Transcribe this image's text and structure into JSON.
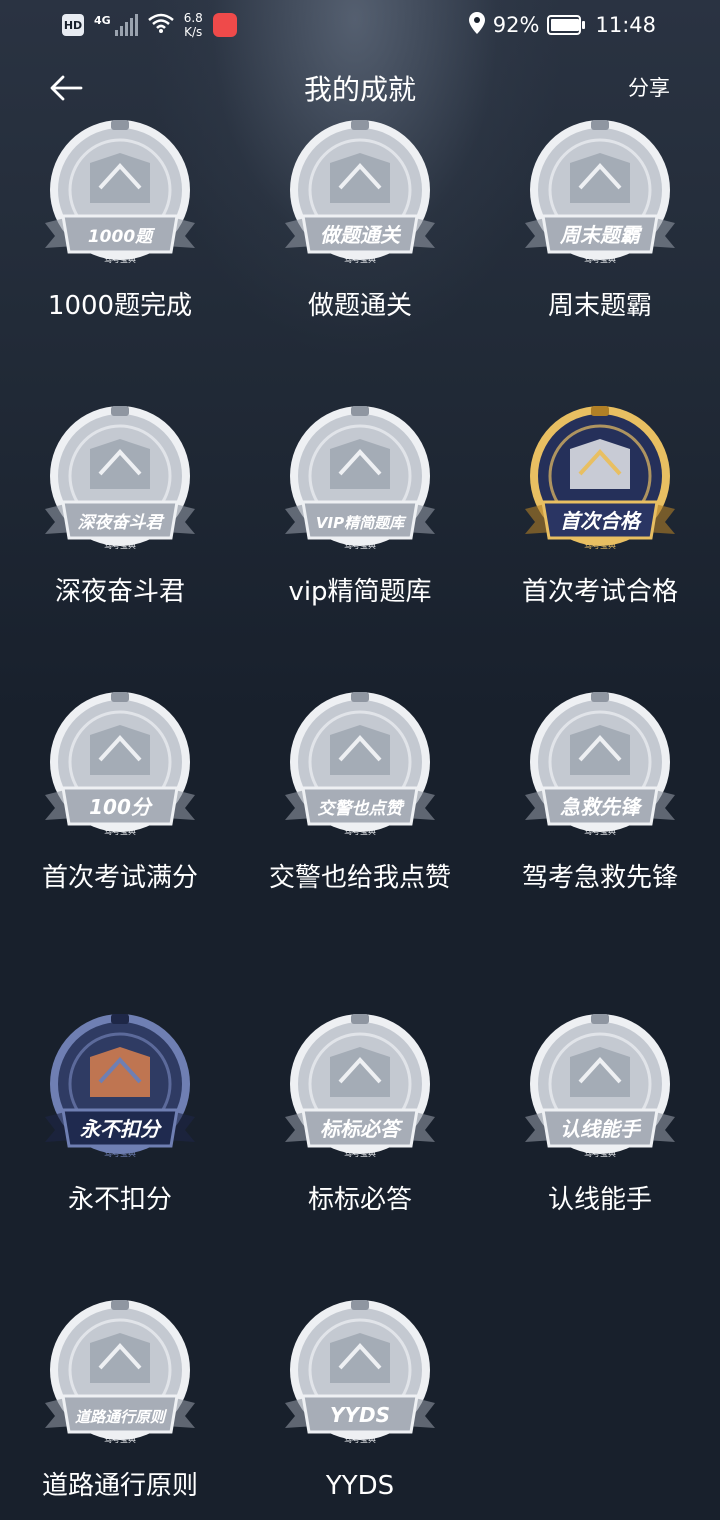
{
  "status": {
    "hd": "HD",
    "network": "4G",
    "speed_top": "6.8",
    "speed_bottom": "K/s",
    "battery": "92%",
    "time": "11:48"
  },
  "header": {
    "title": "我的成就",
    "share": "分享"
  },
  "achievements": [
    {
      "badge": "1000题",
      "label": "1000题完成",
      "icon": "flag-icon",
      "style": "silver"
    },
    {
      "badge": "做题通关",
      "label": "做题通关",
      "icon": "book-icon",
      "style": "silver"
    },
    {
      "badge": "周末题霸",
      "label": "周末题霸",
      "icon": "fist-icon",
      "style": "silver"
    },
    {
      "badge": "深夜奋斗君",
      "label": "深夜奋斗君",
      "icon": "moon-icon",
      "style": "silver"
    },
    {
      "badge": "VIP精简题库",
      "label": "vip精简题库",
      "icon": "diamond-icon",
      "style": "silver"
    },
    {
      "badge": "首次合格",
      "label": "首次考试合格",
      "icon": "trophy-icon",
      "style": "gold"
    },
    {
      "badge": "100分",
      "label": "首次考试满分",
      "icon": "crown-icon",
      "style": "silver"
    },
    {
      "badge": "交警也点赞",
      "label": "交警也给我点赞",
      "icon": "thumbs-up-icon",
      "style": "silver"
    },
    {
      "badge": "急救先锋",
      "label": "驾考急救先锋",
      "icon": "first-aid-icon",
      "style": "silver"
    },
    {
      "badge": "永不扣分",
      "label": "永不扣分",
      "icon": "crown-icon",
      "style": "navy"
    },
    {
      "badge": "标标必答",
      "label": "标标必答",
      "icon": "road-sign-icon",
      "style": "silver"
    },
    {
      "badge": "认线能手",
      "label": "认线能手",
      "icon": "magnifier-icon",
      "style": "silver"
    },
    {
      "badge": "道路通行原则",
      "label": "道路通行原则",
      "icon": "handshake-icon",
      "style": "silver"
    },
    {
      "badge": "YYDS",
      "label": "YYDS",
      "icon": "crown-icon",
      "style": "silver"
    }
  ],
  "badge_footer": "驾考宝典",
  "colors": {
    "background": "#18202c",
    "silver": "#c9ced6",
    "gold": "#d9a441",
    "navy": "#2d3b66"
  }
}
